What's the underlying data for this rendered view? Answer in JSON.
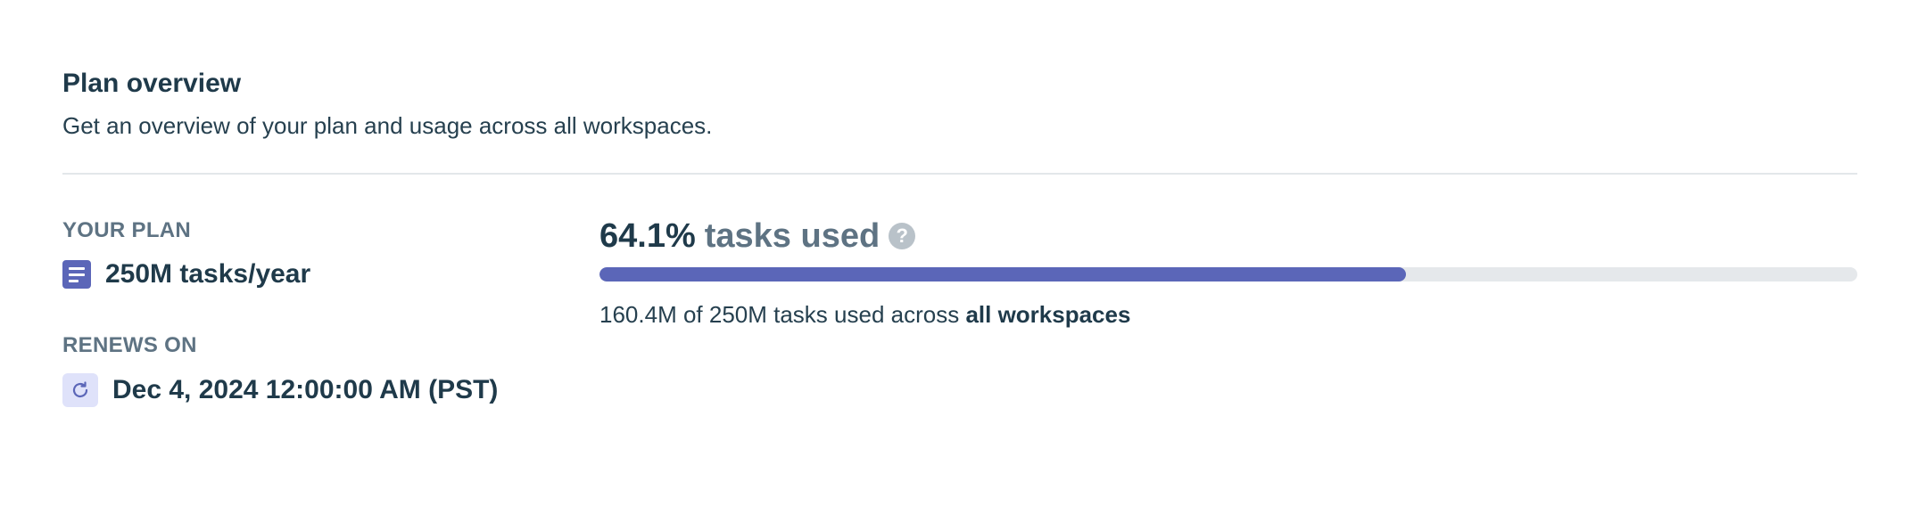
{
  "header": {
    "title": "Plan overview",
    "description": "Get an overview of your plan and usage across all workspaces."
  },
  "plan": {
    "label": "YOUR PLAN",
    "value": "250M tasks/year",
    "icon": "document-icon"
  },
  "renewal": {
    "label": "RENEWS ON",
    "value": "Dec 4, 2024 12:00:00 AM (PST)",
    "icon": "refresh-icon"
  },
  "usage": {
    "percent_text": "64.1%",
    "suffix": "tasks used",
    "percent_value": 64.1,
    "help_icon": "question-circle-icon",
    "detail_prefix": "160.4M of 250M tasks used across",
    "detail_emphasis": "all workspaces"
  },
  "colors": {
    "accent": "#5b66b8",
    "track": "#e5e8eb",
    "text_primary": "#1f3a4a",
    "text_muted": "#5e7383"
  }
}
